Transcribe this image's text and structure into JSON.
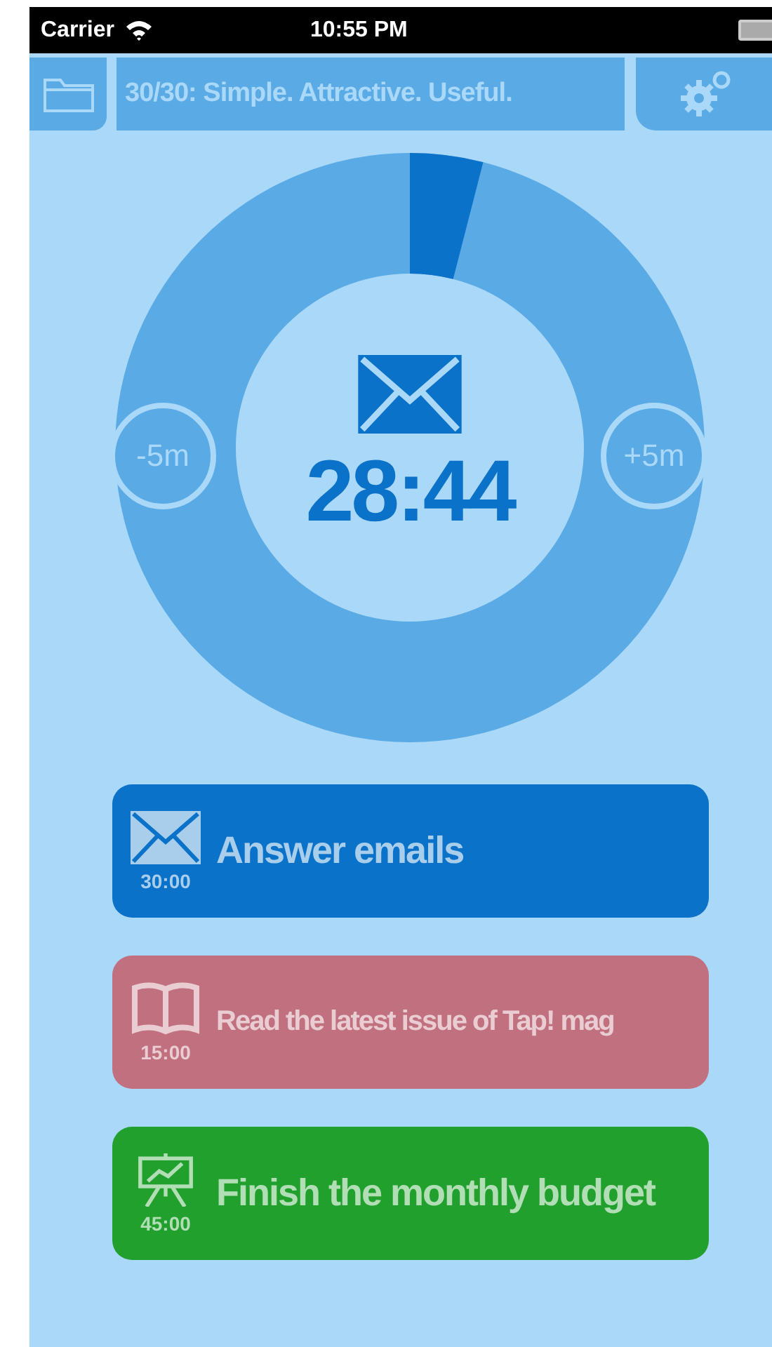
{
  "status_bar": {
    "carrier": "Carrier",
    "time": "10:55 PM"
  },
  "nav": {
    "title": "30/30: Simple. Attractive. Useful."
  },
  "timer": {
    "kind": "email",
    "time": "28:44",
    "minus": "-5m",
    "plus": "+5m"
  },
  "tasks": [
    {
      "kind": "email",
      "title": "Answer emails",
      "duration": "30:00",
      "color": "#0a72c8"
    },
    {
      "kind": "book",
      "title": "Read the latest issue of Tap! mag",
      "duration": "15:00",
      "color": "#c0707e"
    },
    {
      "kind": "chart",
      "title": "Finish the monthly budget",
      "duration": "45:00",
      "color": "#22a02e"
    }
  ]
}
